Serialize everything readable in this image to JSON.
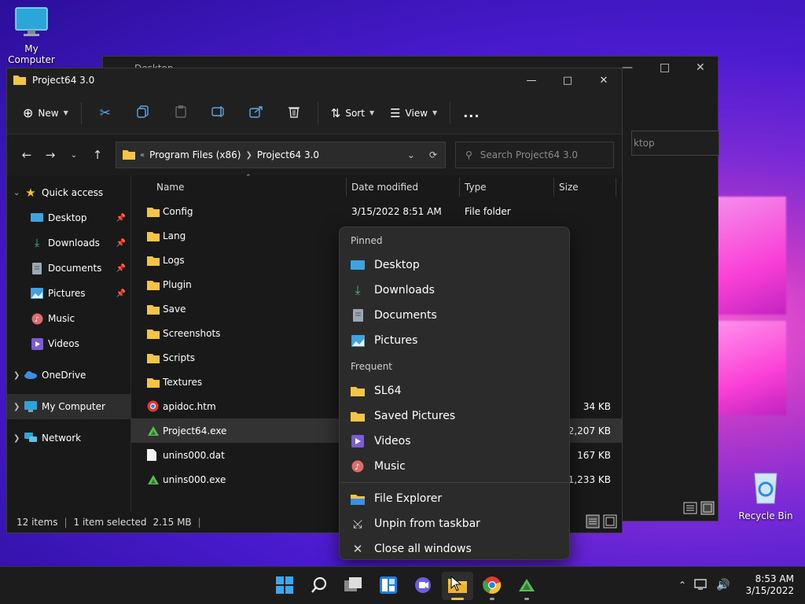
{
  "desktop": {
    "my_computer_label": "My Computer",
    "recycle_bin_label": "Recycle Bin"
  },
  "bg_window": {
    "title": "Desktop",
    "search_text": "ktop"
  },
  "window": {
    "title": "Project64 3.0",
    "commands": {
      "new": "New",
      "sort": "Sort",
      "view": "View",
      "more": "..."
    },
    "address": {
      "overflow": "«",
      "crumb1": "Program Files (x86)",
      "crumb2": "Project64 3.0"
    },
    "search_placeholder": "Search Project64 3.0",
    "nav": {
      "quick_access": "Quick access",
      "desktop": "Desktop",
      "downloads": "Downloads",
      "documents": "Documents",
      "pictures": "Pictures",
      "music": "Music",
      "videos": "Videos",
      "onedrive": "OneDrive",
      "my_computer": "My Computer",
      "network": "Network"
    },
    "columns": {
      "name": "Name",
      "date": "Date modified",
      "type": "Type",
      "size": "Size"
    },
    "files": [
      {
        "name": "Config",
        "date": "3/15/2022 8:51 AM",
        "type": "File folder",
        "size": ""
      },
      {
        "name": "Lang",
        "date": "",
        "type": "",
        "size": ""
      },
      {
        "name": "Logs",
        "date": "",
        "type": "",
        "size": ""
      },
      {
        "name": "Plugin",
        "date": "",
        "type": "",
        "size": ""
      },
      {
        "name": "Save",
        "date": "",
        "type": "",
        "size": ""
      },
      {
        "name": "Screenshots",
        "date": "",
        "type": "",
        "size": ""
      },
      {
        "name": "Scripts",
        "date": "",
        "type": "",
        "size": ""
      },
      {
        "name": "Textures",
        "date": "",
        "type": "",
        "size": ""
      },
      {
        "name": "apidoc.htm",
        "date": "",
        "type": "",
        "size": "34 KB"
      },
      {
        "name": "Project64.exe",
        "date": "",
        "type": "",
        "size": "2,207 KB"
      },
      {
        "name": "unins000.dat",
        "date": "",
        "type": "",
        "size": "167 KB"
      },
      {
        "name": "unins000.exe",
        "date": "",
        "type": "",
        "size": "1,233 KB"
      }
    ],
    "status": {
      "count": "12 items",
      "selected": "1 item selected",
      "sel_size": "2.15 MB"
    }
  },
  "jumplist": {
    "pinned_header": "Pinned",
    "pinned": [
      "Desktop",
      "Downloads",
      "Documents",
      "Pictures"
    ],
    "frequent_header": "Frequent",
    "frequent": [
      "SL64",
      "Saved Pictures",
      "Videos",
      "Music"
    ],
    "actions": [
      "File Explorer",
      "Unpin from taskbar",
      "Close all windows"
    ]
  },
  "taskbar": {
    "time": "8:53 AM",
    "date": "3/15/2022"
  }
}
